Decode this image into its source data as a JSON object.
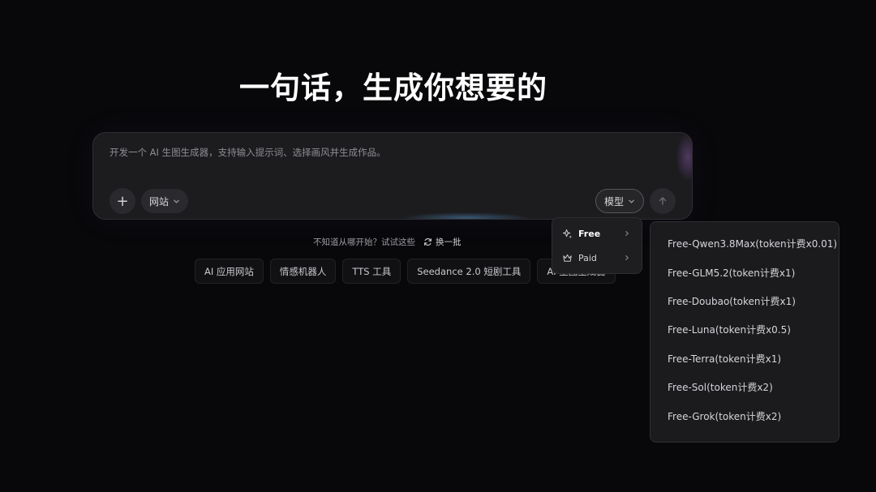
{
  "headline": "一句话，生成你想要的",
  "prompt": {
    "placeholder": "开发一个 AI 生图生成器，支持输入提示词、选择画风并生成作品。",
    "add_label": "+",
    "website_label": "网站",
    "model_label": "模型"
  },
  "suggestions": {
    "hint": "不知道从哪开始？试试这些",
    "refresh_label": "换一批",
    "chips": [
      "AI 应用网站",
      "情感机器人",
      "TTS 工具",
      "Seedance 2.0 短剧工具",
      "AI 生图生成器"
    ]
  },
  "model_menu": {
    "items": [
      {
        "label": "Free",
        "icon": "sparkle-icon"
      },
      {
        "label": "Paid",
        "icon": "crown-icon"
      }
    ],
    "free_models": [
      "Free-Qwen3.8Max(token计费x0.01)",
      "Free-GLM5.2(token计费x1)",
      "Free-Doubao(token计费x1)",
      "Free-Luna(token计费x0.5)",
      "Free-Terra(token计费x1)",
      "Free-Sol(token计费x2)",
      "Free-Grok(token计费x2)"
    ]
  },
  "colors": {
    "background": "#08080a",
    "panel": "#1c1c1f",
    "text": "#d6d6da"
  }
}
